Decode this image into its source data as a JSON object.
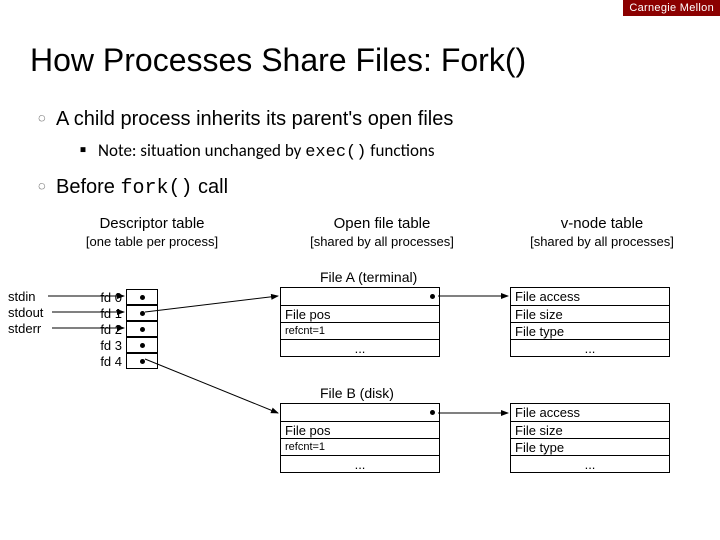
{
  "brand": "Carnegie Mellon",
  "title": "How Processes Share Files: Fork()",
  "bullets": {
    "b1": "A child process inherits its parent's open files",
    "b2_prefix": "Note: situation unchanged by ",
    "b2_code": "exec()",
    "b2_suffix": " functions",
    "b3_prefix": "Before ",
    "b3_code": "fork()",
    "b3_suffix": " call"
  },
  "columns": {
    "c1_title": "Descriptor table",
    "c1_sub": "[one table per process]",
    "c2_title": "Open file table",
    "c2_sub": "[shared by all processes]",
    "c3_title": "v-node table",
    "c3_sub": "[shared by all processes]"
  },
  "stdio": [
    "stdin",
    "stdout",
    "stderr"
  ],
  "fds": [
    "fd 0",
    "fd 1",
    "fd 2",
    "fd 3",
    "fd 4"
  ],
  "fileA": {
    "label": "File A (terminal)",
    "rows": [
      "",
      "File pos",
      "refcnt=1",
      "..."
    ]
  },
  "fileB": {
    "label": "File B (disk)",
    "rows": [
      "",
      "File pos",
      "refcnt=1",
      "..."
    ]
  },
  "vnode": {
    "rows": [
      "File access",
      "File size",
      "File type",
      "..."
    ]
  }
}
